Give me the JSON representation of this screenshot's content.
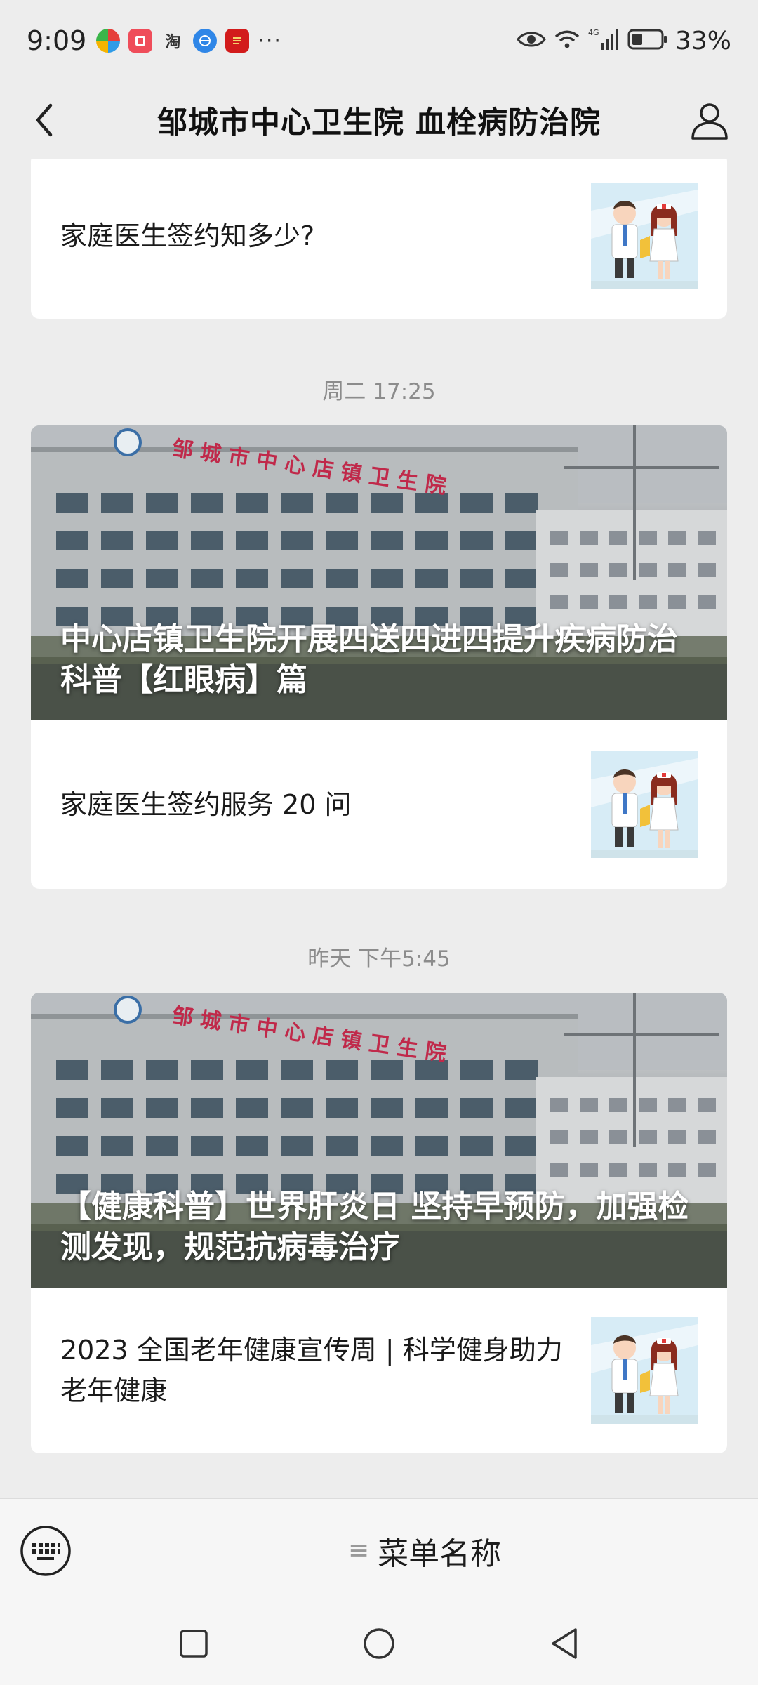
{
  "status_bar": {
    "time": "9:09",
    "overflow": "···",
    "battery_percent": "33%",
    "network": "4G",
    "app_icons": [
      "pinwheel-app-icon",
      "red-book-app-icon",
      "taobao-app-icon",
      "blue-globe-app-icon",
      "red-news-app-icon"
    ],
    "taobao_glyph": "淘"
  },
  "header": {
    "title": "邹城市中心卫生院 血栓病防治院"
  },
  "feed": {
    "top_card": {
      "text": "家庭医生签约知多少?"
    },
    "groups": [
      {
        "timestamp": "周二 17:25",
        "cover_title": "中心店镇卫生院开展四送四进四提升疾病防治科普【红眼病】篇",
        "building_sign": "邹 城 市 中 心 店 镇 卫 生 院",
        "row_text": "家庭医生签约服务 20 问"
      },
      {
        "timestamp": "昨天 下午5:45",
        "cover_title": "【健康科普】世界肝炎日 坚持早预防，加强检测发现，规范抗病毒治疗",
        "building_sign": "邹 城 市 中 心 店 镇 卫 生 院",
        "row_text": "2023 全国老年健康宣传周 | 科学健身助力老年健康"
      }
    ]
  },
  "menu": {
    "item_label": "菜单名称",
    "item_marker": "≡"
  },
  "colors": {
    "background": "#ededed",
    "card": "#ffffff",
    "timestamp": "#8c8c8c",
    "sign_red": "#c0294a"
  }
}
